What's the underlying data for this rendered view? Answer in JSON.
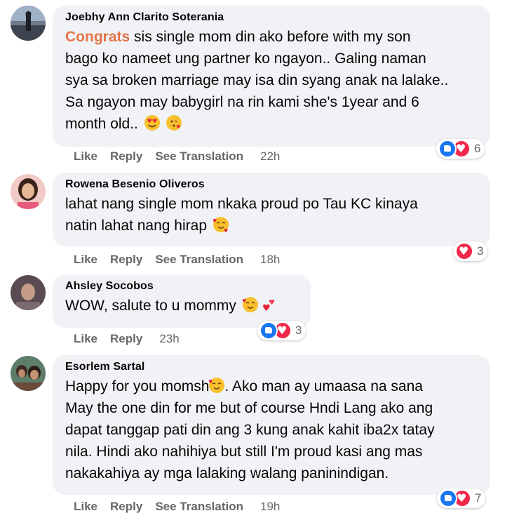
{
  "comments": [
    {
      "author": "Joebhy Ann Clarito Soterania",
      "tag": "Congrats",
      "lines": [
        " sis single mom din ako before with my son",
        "bago ko nameet ung partner ko ngayon.. Galing naman",
        "sya sa broken marriage may isa din syang anak na lalake..",
        "Sa ngayon may babygirl na rin kami she's 1year and 6",
        "month old.."
      ],
      "actions": {
        "like": "Like",
        "reply": "Reply",
        "translate": "See Translation",
        "time": "22h"
      },
      "reaction_count": "6"
    },
    {
      "author": "Rowena Besenio Oliveros",
      "lines": [
        "lahat nang single mom nkaka proud po Tau KC kinaya",
        "natin lahat nang hirap"
      ],
      "actions": {
        "like": "Like",
        "reply": "Reply",
        "translate": "See Translation",
        "time": "18h"
      },
      "reaction_count": "3"
    },
    {
      "author": "Ahsley Socobos",
      "lines": [
        "WOW, salute to u mommy"
      ],
      "actions": {
        "like": "Like",
        "reply": "Reply",
        "time": "23h"
      },
      "reaction_count": "3"
    },
    {
      "author": "Esorlem Sartal",
      "lines": [
        "Happy for you momsh",
        "May the one din for me but of course Hndi Lang ako ang",
        "dapat tanggap pati din ang 3 kung anak kahit iba2x tatay",
        "nila. Hindi ako nahihiya but still I'm proud kasi ang mas",
        "nakakahiya ay mga lalaking walang paninindigan."
      ],
      "line1_suffix": ". Ako man ay umaasa na sana",
      "actions": {
        "like": "Like",
        "reply": "Reply",
        "translate": "See Translation",
        "time": "19h"
      },
      "reaction_count": "7"
    }
  ],
  "colors": {
    "bubble": "#f0f2f5",
    "tag": "#e4754a",
    "meta": "#65676b",
    "like": "#1877f2",
    "love": "#f02849"
  },
  "icons": [
    "like-reaction-icon",
    "love-reaction-icon",
    "heart-eyes-emoji",
    "kiss-emoji",
    "smiling-hearts-emoji",
    "two-hearts-emoji"
  ]
}
